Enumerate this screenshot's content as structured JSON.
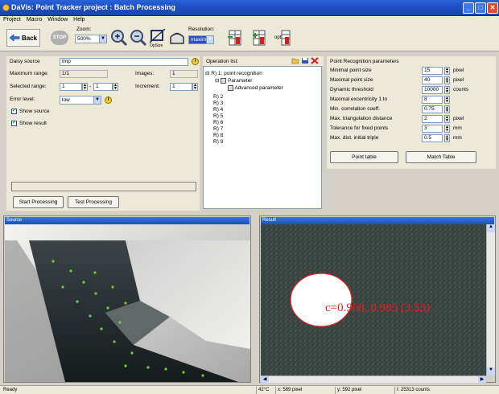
{
  "window": {
    "title": "DaVis: Point Tracker project : Batch Processing",
    "min": "_",
    "max": "□",
    "close": "✕"
  },
  "menu": [
    "Project",
    "Macro",
    "Window",
    "Help"
  ],
  "toolbar": {
    "back_label": "Back",
    "stop_label": "STOP",
    "zoom_label": "Zoom:",
    "zoom_value": "500%",
    "optsize_label": "OpSize",
    "resolution_label": "Resolution:",
    "resolution_value": "maximal",
    "opt_label": "opt"
  },
  "left_panel": {
    "daisy_source_label": "Daisy source",
    "daisy_source_value": "tmp",
    "maximum_range_label": "Maximum range:",
    "maximum_range_value": "1/1",
    "images_label": "Images:",
    "images_value": "1",
    "selected_range_label": "Selected range:",
    "selected_from": "1",
    "selected_to": "1",
    "increment_label": "Increment:",
    "increment_value": "1",
    "error_level_label": "Error level:",
    "error_level_value": "low",
    "show_source_label": "Show source",
    "show_result_label": "Show result",
    "start_processing": "Start Processing",
    "test_processing": "Test Processing"
  },
  "oplist": {
    "title": "Operation list:",
    "items": [
      "R) 1: point recognition",
      "Parameter",
      "Advanced parameter",
      "R) 2",
      "R) 3",
      "R) 4",
      "R) 5",
      "R) 6",
      "R) 7",
      "R) 8",
      "R) 9"
    ]
  },
  "params": {
    "title": "Point Recognition parameters",
    "rows": [
      {
        "label": "Minimal point size",
        "value": "15",
        "unit": "pixel"
      },
      {
        "label": "Maximal point size",
        "value": "40",
        "unit": "pixel"
      },
      {
        "label": "Dynamic threshold",
        "value": "10000",
        "unit": "counts"
      },
      {
        "label": "Maximal excentricity 1 to",
        "value": "8",
        "unit": ""
      },
      {
        "label": "Min. correlation coeff.",
        "value": "0.75",
        "unit": ""
      },
      {
        "label": "Max. triangulation distance",
        "value": "2",
        "unit": "pixel"
      },
      {
        "label": "Tolerance for fixed points",
        "value": "3",
        "unit": "mm"
      },
      {
        "label": "Max. dist. initial triple",
        "value": "0.5",
        "unit": "mm"
      }
    ],
    "point_table": "Point table",
    "match_table": "Match Table"
  },
  "source_panel": {
    "title": "Source"
  },
  "result_panel": {
    "title": "Result",
    "annotation": "c=0.968, 0.985 (3.53)"
  },
  "status": {
    "ready": "Ready",
    "temp": "42°C",
    "x": "x: 589 pixel",
    "y": "y: 592 pixel",
    "counts": "I: 25313 counts"
  },
  "colors": {
    "titlebar": "#1f4fc4",
    "annotation": "#e02020",
    "points": "#70d040"
  }
}
